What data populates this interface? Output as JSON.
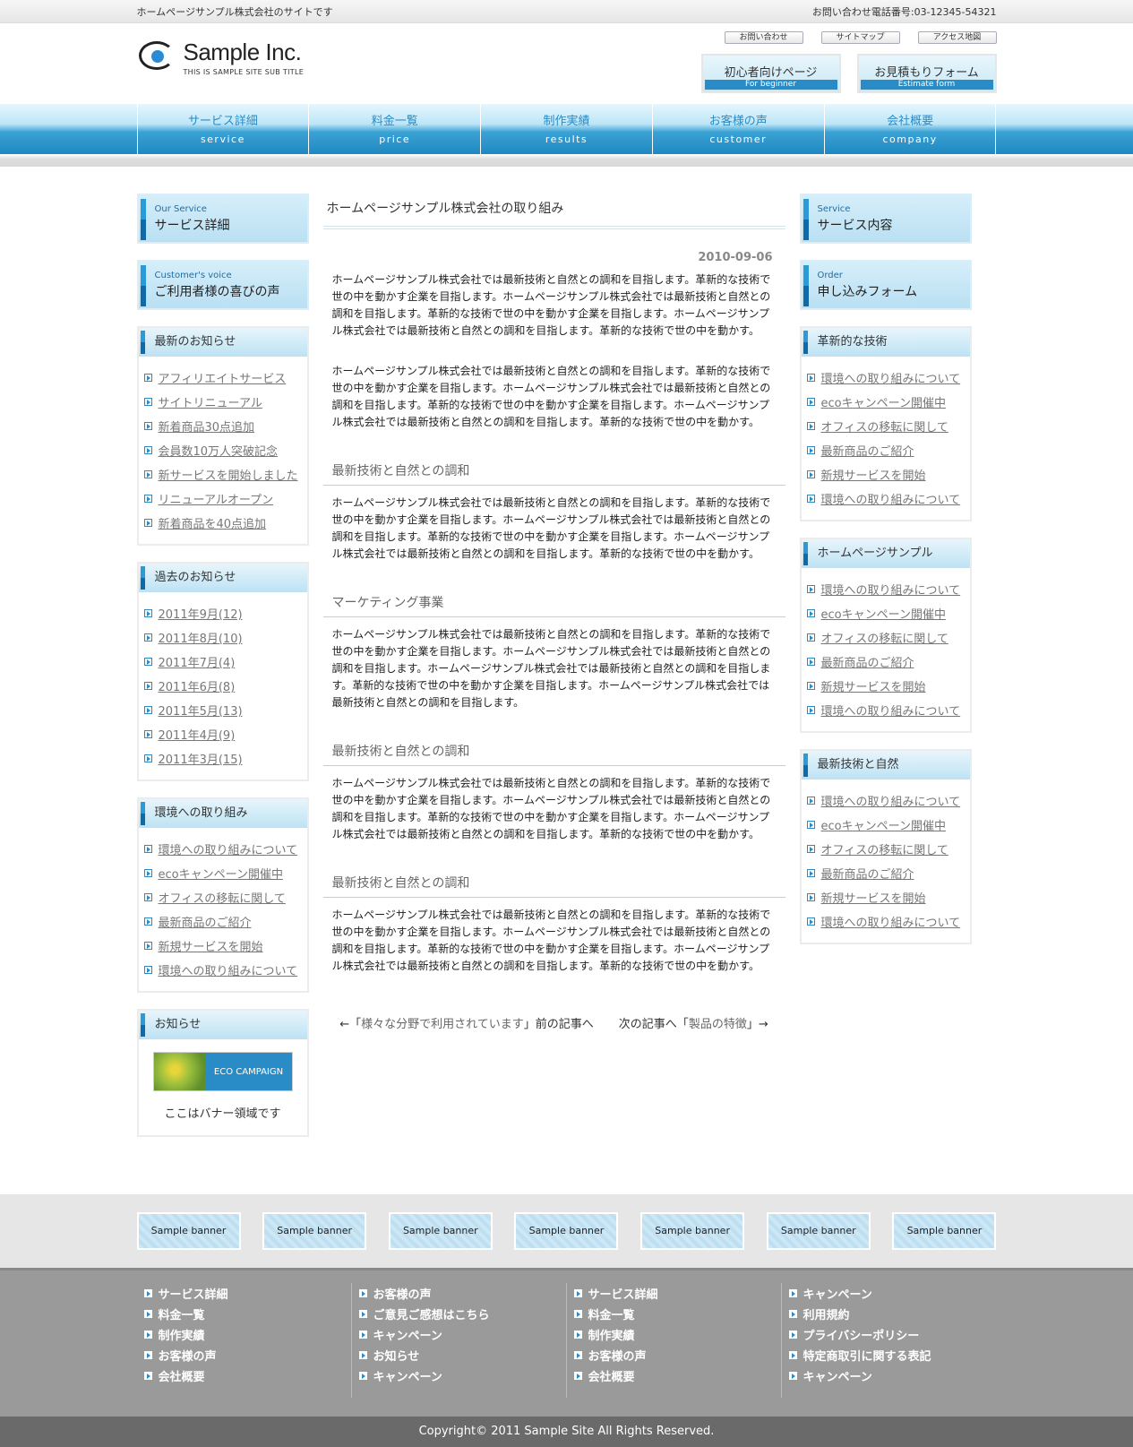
{
  "topbar": {
    "site_desc": "ホームページサンプル株式会社のサイトです",
    "phone": "お問い合わせ電話番号:03-12345-54321"
  },
  "header": {
    "logo_name": "Sample Inc.",
    "logo_sub": "THIS IS SAMPLE SITE SUB TITLE",
    "util_links": [
      "お問い合わせ",
      "サイトマップ",
      "アクセス地図"
    ],
    "big_buttons": [
      {
        "jp": "初心者向けページ",
        "en": "For beginner"
      },
      {
        "jp": "お見積もりフォーム",
        "en": "Estimate form"
      }
    ]
  },
  "nav": [
    {
      "jp": "サービス詳細",
      "en": "service"
    },
    {
      "jp": "料金一覧",
      "en": "price"
    },
    {
      "jp": "制作実績",
      "en": "results"
    },
    {
      "jp": "お客様の声",
      "en": "customer"
    },
    {
      "jp": "会社概要",
      "en": "company"
    }
  ],
  "left": {
    "svc1": {
      "en": "Our Service",
      "jp": "サービス詳細"
    },
    "svc2": {
      "en": "Customer's voice",
      "jp": "ご利用者様の喜びの声"
    },
    "news": {
      "title": "最新のお知らせ",
      "items": [
        "アフィリエイトサービス",
        "サイトリニューアル",
        "新着商品30点追加",
        "会員数10万人突破記念",
        "新サービスを開始しました",
        "リニューアルオープン",
        "新着商品を40点追加"
      ]
    },
    "archive": {
      "title": "過去のお知らせ",
      "items": [
        "2011年9月(12)",
        "2011年8月(10)",
        "2011年7月(4)",
        "2011年6月(8)",
        "2011年5月(13)",
        "2011年4月(9)",
        "2011年3月(15)"
      ]
    },
    "env": {
      "title": "環境への取り組み",
      "items": [
        "環境への取り組みについて",
        "ecoキャンペーン開催中",
        "オフィスの移転に関して",
        "最新商品のご紹介",
        "新規サービスを開始",
        "環境への取り組みについて"
      ]
    },
    "notice": {
      "title": "お知らせ",
      "banner_label": "ECO CAMPAIGN",
      "caption": "ここはバナー領域です"
    }
  },
  "content": {
    "title": "ホームページサンプル株式会社の取り組み",
    "date": "2010-09-06",
    "p1": "ホームページサンプル株式会社では最新技術と自然との調和を目指します。革新的な技術で世の中を動かす企業を目指します。ホームページサンプル株式会社では最新技術と自然との調和を目指します。革新的な技術で世の中を動かす企業を目指します。ホームページサンプル株式会社では最新技術と自然との調和を目指します。革新的な技術で世の中を動かす。",
    "p2": "ホームページサンプル株式会社では最新技術と自然との調和を目指します。革新的な技術で世の中を動かす企業を目指します。ホームページサンプル株式会社では最新技術と自然との調和を目指します。革新的な技術で世の中を動かす企業を目指します。ホームページサンプル株式会社では最新技術と自然との調和を目指します。革新的な技術で世の中を動かす。",
    "sections": [
      {
        "head": "最新技術と自然との調和",
        "body": "ホームページサンプル株式会社では最新技術と自然との調和を目指します。革新的な技術で世の中を動かす企業を目指します。ホームページサンプル株式会社では最新技術と自然との調和を目指します。革新的な技術で世の中を動かす企業を目指します。ホームページサンプル株式会社では最新技術と自然との調和を目指します。革新的な技術で世の中を動かす。"
      },
      {
        "head": "マーケティング事業",
        "body": "ホームページサンプル株式会社では最新技術と自然との調和を目指します。革新的な技術で世の中を動かす企業を目指します。ホームページサンプル株式会社では最新技術と自然との調和を目指します。ホームページサンプル株式会社では最新技術と自然との調和を目指します。革新的な技術で世の中を動かす企業を目指します。ホームページサンプル株式会社では最新技術と自然との調和を目指します。"
      },
      {
        "head": "最新技術と自然との調和",
        "body": "ホームページサンプル株式会社では最新技術と自然との調和を目指します。革新的な技術で世の中を動かす企業を目指します。ホームページサンプル株式会社では最新技術と自然との調和を目指します。革新的な技術で世の中を動かす企業を目指します。ホームページサンプル株式会社では最新技術と自然との調和を目指します。革新的な技術で世の中を動かす。"
      },
      {
        "head": "最新技術と自然との調和",
        "body": "ホームページサンプル株式会社では最新技術と自然との調和を目指します。革新的な技術で世の中を動かす企業を目指します。ホームページサンプル株式会社では最新技術と自然との調和を目指します。革新的な技術で世の中を動かす企業を目指します。ホームページサンプル株式会社では最新技術と自然との調和を目指します。革新的な技術で世の中を動かす。"
      }
    ],
    "prev_prefix": "←「",
    "prev_link": "様々な分野で利用されています",
    "prev_suffix": "」前の記事へ",
    "next_prefix": "次の記事へ「",
    "next_link": "製品の特徴",
    "next_suffix": "」→"
  },
  "right": {
    "svc1": {
      "en": "Service",
      "jp": "サービス内容"
    },
    "svc2": {
      "en": "Order",
      "jp": "申し込みフォーム"
    },
    "panels": [
      {
        "title": "革新的な技術",
        "items": [
          "環境への取り組みについて",
          "ecoキャンペーン開催中",
          "オフィスの移転に関して",
          "最新商品のご紹介",
          "新規サービスを開始",
          "環境への取り組みについて"
        ]
      },
      {
        "title": "ホームページサンプル",
        "items": [
          "環境への取り組みについて",
          "ecoキャンペーン開催中",
          "オフィスの移転に関して",
          "最新商品のご紹介",
          "新規サービスを開始",
          "環境への取り組みについて"
        ]
      },
      {
        "title": "最新技術と自然",
        "items": [
          "環境への取り組みについて",
          "ecoキャンペーン開催中",
          "オフィスの移転に関して",
          "最新商品のご紹介",
          "新規サービスを開始",
          "環境への取り組みについて"
        ]
      }
    ]
  },
  "banners": [
    "Sample banner",
    "Sample banner",
    "Sample banner",
    "Sample banner",
    "Sample banner",
    "Sample banner",
    "Sample banner"
  ],
  "footer": {
    "cols": [
      [
        "サービス詳細",
        "料金一覧",
        "制作実績",
        "お客様の声",
        "会社概要"
      ],
      [
        "お客様の声",
        "ご意見ご感想はこちら",
        "キャンペーン",
        "お知らせ",
        "キャンペーン"
      ],
      [
        "サービス詳細",
        "料金一覧",
        "制作実績",
        "お客様の声",
        "会社概要"
      ],
      [
        "キャンペーン",
        "利用規約",
        "プライバシーポリシー",
        "特定商取引に関する表記",
        "キャンペーン"
      ]
    ],
    "copyright": "Copyright© 2011 Sample Site All Rights Reserved."
  },
  "colors": {
    "accent": "#2a8cc7",
    "link": "#777777",
    "footer_bg": "#9a9a9a"
  }
}
